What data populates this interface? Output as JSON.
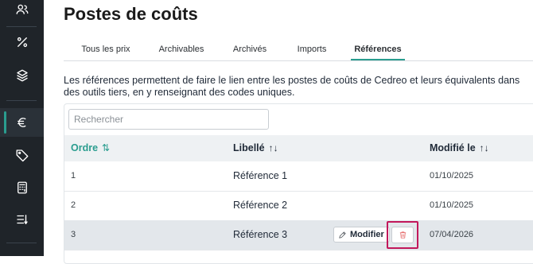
{
  "page": {
    "title": "Postes de coûts",
    "description": "Les références permettent de faire le lien entre les postes de coûts de Cedreo et leurs équivalents dans des outils tiers, en y renseignant des codes uniques."
  },
  "sidebar": {
    "items": [
      {
        "icon": "users-icon"
      },
      {
        "icon": "percent-icon"
      },
      {
        "icon": "layers-icon"
      },
      {
        "icon": "euro-icon",
        "active": true
      },
      {
        "icon": "tag-icon"
      },
      {
        "icon": "calculator-icon"
      },
      {
        "icon": "list-sort-icon"
      }
    ]
  },
  "tabs": [
    {
      "label": "Tous les prix"
    },
    {
      "label": "Archivables"
    },
    {
      "label": "Archivés"
    },
    {
      "label": "Imports"
    },
    {
      "label": "Références",
      "active": true
    }
  ],
  "search": {
    "placeholder": "Rechercher",
    "value": ""
  },
  "table": {
    "columns": [
      {
        "label": "Ordre",
        "sort": "⇅"
      },
      {
        "label": "Libellé",
        "sort": "↑↓"
      },
      {
        "label": "Modifié le",
        "sort": "↑↓"
      }
    ],
    "rows": [
      {
        "order": "1",
        "label": "Référence 1",
        "modified": "01/10/2025"
      },
      {
        "order": "2",
        "label": "Référence 2",
        "modified": "01/10/2025"
      },
      {
        "order": "3",
        "label": "Référence 3",
        "modified": "07/04/2026",
        "hovered": true
      }
    ],
    "row_actions": {
      "edit_label": "Modifier"
    }
  },
  "colors": {
    "accent": "#2a9d8f",
    "sidebar": "#1f2429",
    "highlight": "#c2185b",
    "delete": "#e04b4b"
  }
}
